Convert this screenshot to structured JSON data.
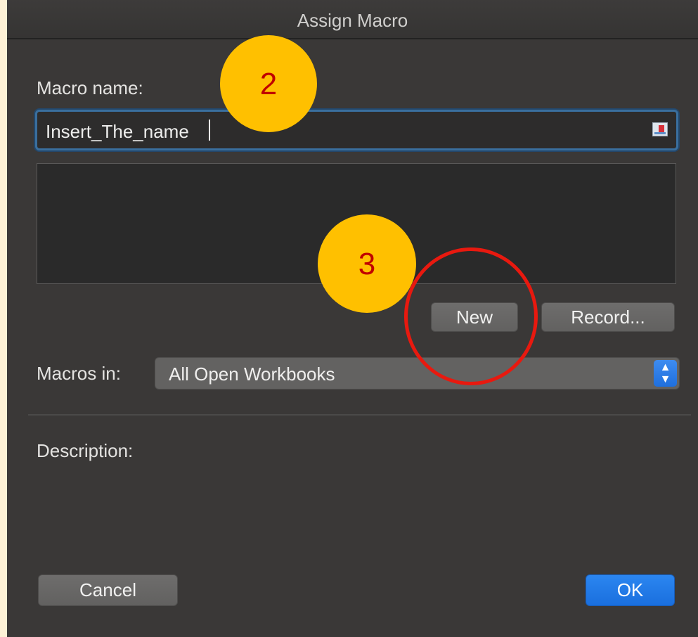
{
  "dialog": {
    "title": "Assign Macro",
    "macro_name_label": "Macro name:",
    "macro_name_value": "Insert_The_name",
    "new_button": "New",
    "record_button": "Record...",
    "macros_in_label": "Macros in:",
    "macros_in_value": "All Open Workbooks",
    "description_label": "Description:",
    "cancel_button": "Cancel",
    "ok_button": "OK"
  },
  "annotations": {
    "step_2": "2",
    "step_3": "3"
  },
  "colors": {
    "badge_fill": "#ffc000",
    "badge_text": "#c00000",
    "highlight_ring": "#e8190f",
    "accent_blue": "#1a6fde"
  },
  "icons": {
    "input_icon": "address-card-icon",
    "select_icon": "chevron-up-down-icon"
  }
}
